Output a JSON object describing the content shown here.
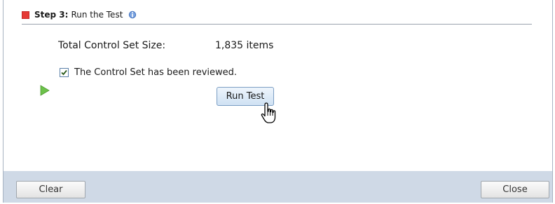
{
  "step": {
    "number_label": "Step 3:",
    "title": "Run the Test",
    "status_color": "#e53935",
    "info_icon": "info-icon"
  },
  "control_set": {
    "size_label": "Total Control Set Size:",
    "size_value": "1,835 items",
    "reviewed_label": "The Control Set has been reviewed.",
    "reviewed_checked": true
  },
  "actions": {
    "run_test_label": "Run Test",
    "play_icon": "play-icon",
    "cursor_icon": "hand-pointer-icon"
  },
  "footer": {
    "clear_label": "Clear",
    "close_label": "Close"
  }
}
